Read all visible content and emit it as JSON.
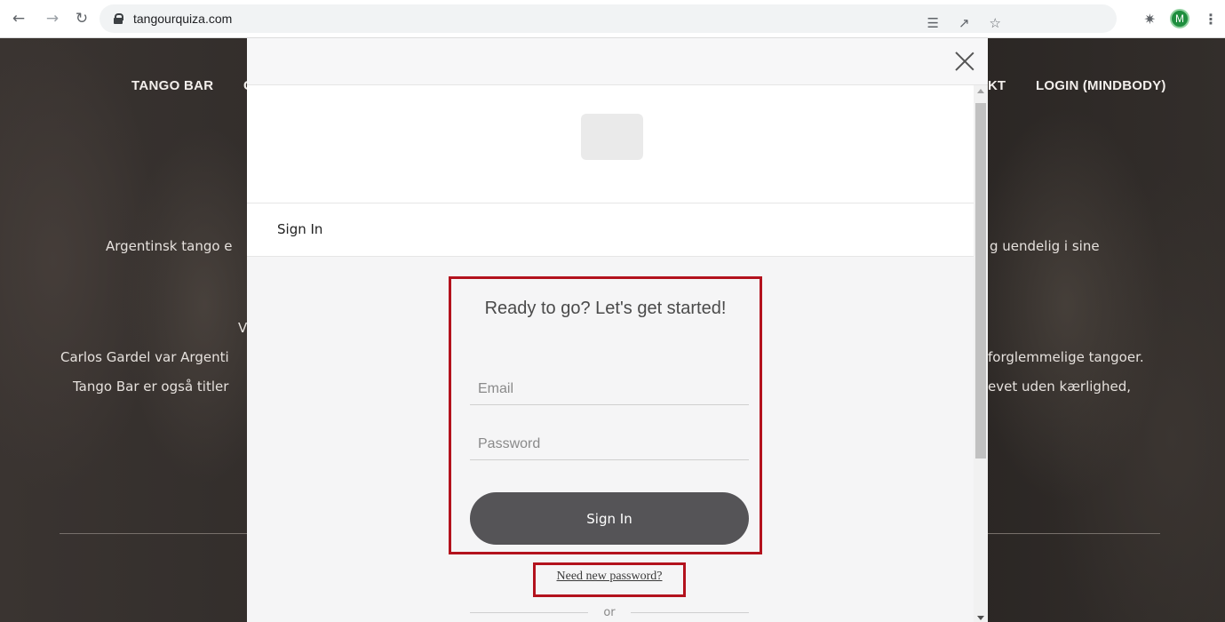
{
  "browser": {
    "url": "tangourquiza.com",
    "nav_icons": [
      "back-arrow-icon",
      "forward-arrow-icon",
      "reload-icon"
    ],
    "omnibox_icons": [
      "translate-icon",
      "share-icon",
      "bookmark-star-icon"
    ],
    "avatar_letter": "M"
  },
  "page": {
    "nav": {
      "tango_bar": "TANGO BAR",
      "left_partial": "C",
      "right_partial": "KT",
      "login": "LOGIN (MINDBODY)"
    },
    "text": {
      "line1_left": "Argentinsk tango e",
      "line1_right": "g uendelig i sine",
      "line2_left": "V",
      "line3_left": "Carlos Gardel var Argenti",
      "line3_right": "forglemmelige tangoer.",
      "line4_left": "Tango Bar er også titler",
      "line4_right": "evet uden kærlighed,"
    }
  },
  "modal": {
    "signin_header": "Sign In",
    "form": {
      "title": "Ready to go? Let's get started!",
      "email_placeholder": "Email",
      "password_placeholder": "Password",
      "submit_label": "Sign In",
      "forgot_link": "Need new password?",
      "or_text": "or"
    },
    "highlight_color": "#b3121d",
    "button_color": "#555457"
  }
}
